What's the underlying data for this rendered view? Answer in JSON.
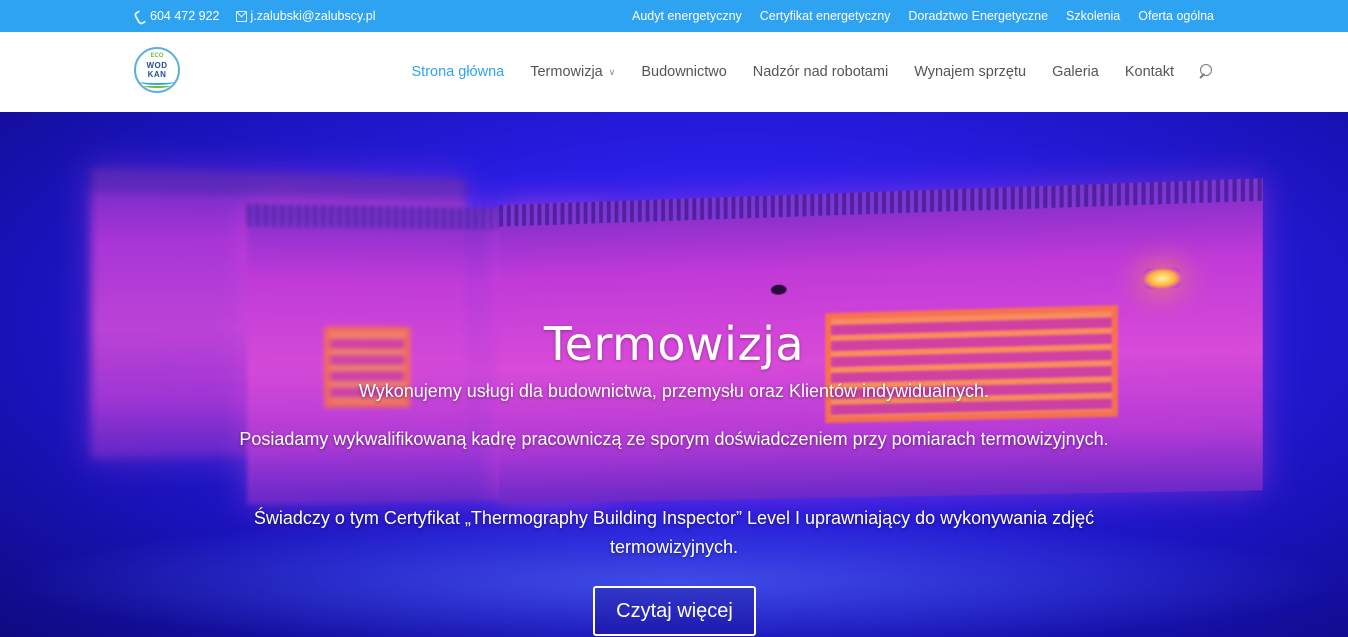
{
  "topbar": {
    "phone": "604 472 922",
    "email": "j.zalubski@zalubscy.pl",
    "links": [
      "Audyt energetyczny",
      "Certyfikat energetyczny",
      "Doradztwo Energetyczne",
      "Szkolenia",
      "Oferta ogólna"
    ],
    "background_color": "#2ea3f2"
  },
  "logo": {
    "line1": "ECO",
    "line2": "WOD",
    "line3": "KAN"
  },
  "nav": {
    "items": [
      {
        "label": "Strona główna",
        "active": true
      },
      {
        "label": "Termowizja",
        "has_dropdown": true,
        "caret": "∨"
      },
      {
        "label": "Budownictwo"
      },
      {
        "label": "Nadzór nad robotami"
      },
      {
        "label": "Wynajem sprzętu"
      },
      {
        "label": "Galeria"
      },
      {
        "label": "Kontakt"
      }
    ],
    "search_icon": "search-icon",
    "active_color": "#2ea3f2"
  },
  "hero": {
    "title": "Termowizja",
    "paragraph1": "Wykonujemy usługi dla budownictwa, przemysłu oraz Klientów indywidualnych.",
    "paragraph2": "Posiadamy wykwalifikowaną kadrę pracowniczą ze sporym doświadczeniem przy pomiarach termowizyjnych.",
    "paragraph3": "Świadczy o tym Certyfikat „Thermography Building Inspector” Level I uprawniający do wykonywania zdjęć termowizyjnych.",
    "button_label": "Czytaj więcej"
  }
}
